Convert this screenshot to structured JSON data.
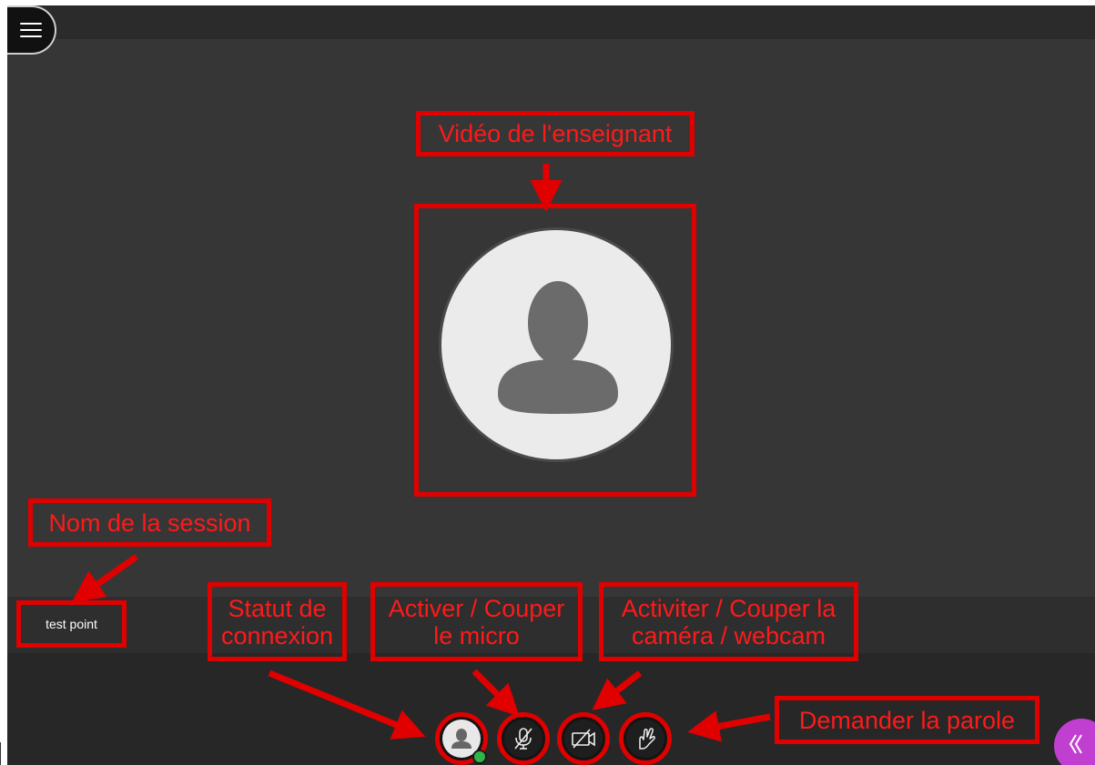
{
  "session": {
    "name": "test point"
  },
  "annotations": {
    "teacher_video": "Vidéo de l'enseignant",
    "session_name": "Nom de la session",
    "connection_status": [
      "Statut de",
      "connexion"
    ],
    "mic": [
      "Activer / Couper",
      "le micro"
    ],
    "camera": [
      "Activiter / Couper la",
      "caméra / webcam"
    ],
    "raise_hand": "Demander la parole"
  },
  "controls": [
    {
      "id": "status",
      "icon": "user-avatar-icon",
      "status": "online"
    },
    {
      "id": "microphone",
      "icon": "microphone-muted-icon"
    },
    {
      "id": "camera",
      "icon": "camera-off-icon"
    },
    {
      "id": "raise-hand",
      "icon": "raise-hand-icon"
    }
  ],
  "colors": {
    "annotation": "#e00000",
    "background": "#363636",
    "online_status": "#2fb54a",
    "collapse_button": "#c13fd0"
  }
}
